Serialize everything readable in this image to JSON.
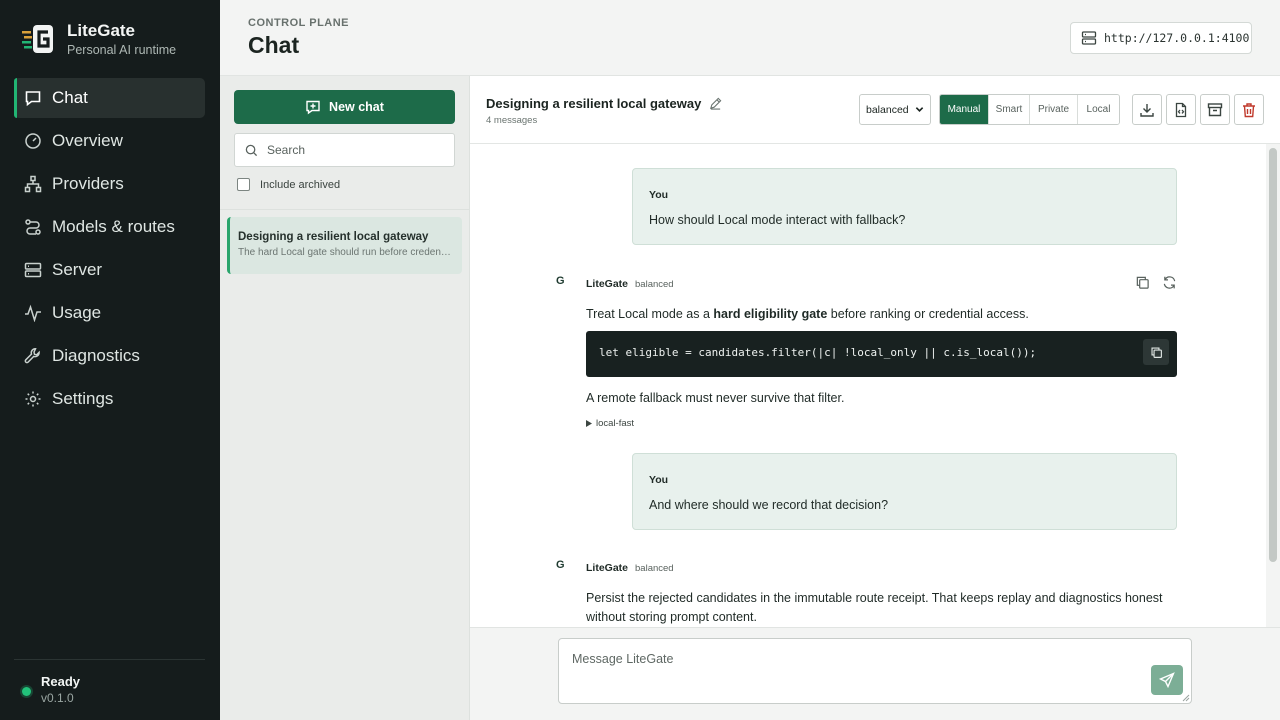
{
  "brand": {
    "name": "LiteGate",
    "subtitle": "Personal AI runtime"
  },
  "nav": [
    {
      "label": "Chat",
      "icon": "chat-icon",
      "active": true
    },
    {
      "label": "Overview",
      "icon": "gauge-icon"
    },
    {
      "label": "Providers",
      "icon": "providers-icon"
    },
    {
      "label": "Models & routes",
      "icon": "routes-icon"
    },
    {
      "label": "Server",
      "icon": "server-icon"
    },
    {
      "label": "Usage",
      "icon": "activity-icon"
    },
    {
      "label": "Diagnostics",
      "icon": "wrench-icon"
    },
    {
      "label": "Settings",
      "icon": "gear-icon"
    }
  ],
  "status": {
    "label": "Ready",
    "version": "v0.1.0",
    "color": "#22c27a"
  },
  "header": {
    "eyebrow": "CONTROL PLANE",
    "title": "Chat",
    "endpoint": "http://127.0.0.1:4100"
  },
  "sidebar_list": {
    "new_chat": "New chat",
    "search_placeholder": "Search",
    "include_archived": "Include archived",
    "conversations": [
      {
        "title": "Designing a resilient local gateway",
        "preview": "The hard Local gate should run before credential access."
      }
    ]
  },
  "chat": {
    "title": "Designing a resilient local gateway",
    "count": "4 messages",
    "profile": "balanced",
    "modes": [
      {
        "label": "Manual",
        "active": true
      },
      {
        "label": "Smart"
      },
      {
        "label": "Private"
      },
      {
        "label": "Local"
      }
    ],
    "messages": [
      {
        "role": "user",
        "label": "You",
        "text": "How should Local mode interact with fallback?"
      },
      {
        "role": "assistant",
        "avatar": "G",
        "label": "LiteGate",
        "route": "balanced",
        "text_pre": "Treat Local mode as a ",
        "text_bold": "hard eligibility gate",
        "text_post": " before ranking or credential access.",
        "code": "let eligible = candidates.filter(|c| !local_only || c.is_local());",
        "after": "A remote fallback must never survive that filter.",
        "details": "local-fast"
      },
      {
        "role": "user",
        "label": "You",
        "text": "And where should we record that decision?"
      },
      {
        "role": "assistant",
        "avatar": "G",
        "label": "LiteGate",
        "route": "balanced",
        "text": "Persist the rejected candidates in the immutable route receipt. That keeps replay and diagnostics honest without storing prompt content."
      }
    ],
    "composer_placeholder": "Message LiteGate"
  },
  "colors": {
    "accent": "#1d6b49",
    "sidebar_bg": "#151c1c",
    "active_indicator": "#22b574",
    "danger": "#c0392b"
  }
}
